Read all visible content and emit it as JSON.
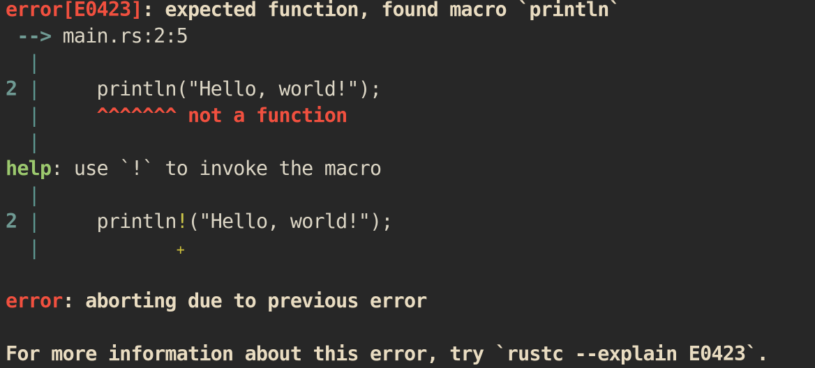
{
  "terminal": {
    "error_head": {
      "label": "error[E0423]",
      "message": ": expected function, found macro `println`"
    },
    "location": {
      "arrow": " -->",
      "path": " main.rs:2:5"
    },
    "gutter": {
      "pipe": "  |",
      "line_no": "2",
      "line_pipe": " |"
    },
    "snippet1": {
      "indent": "     ",
      "code": "println(\"Hello, world!\");"
    },
    "annotation": {
      "indent": "     ",
      "carets": "^^^^^^^",
      "note": " not a function"
    },
    "help": {
      "label": "help",
      "message": ": use `!` to invoke the macro"
    },
    "snippet2": {
      "indent": "     ",
      "code_before": "println",
      "bang": "!",
      "code_after": "(\"Hello, world!\");"
    },
    "suggestion": {
      "indent": "            ",
      "plus": "+"
    },
    "abort": {
      "label": "error",
      "message": ": aborting due to previous error"
    },
    "info": {
      "message": "For more information about this error, try `rustc --explain E0423`."
    }
  },
  "colors": {
    "background": "#272727",
    "error_red": "#f1503f",
    "help_green": "#9cc96e",
    "gutter_teal": "#6f9a93",
    "text_cream": "#e9dcc1",
    "suggest_yellow": "#ccc64a"
  }
}
